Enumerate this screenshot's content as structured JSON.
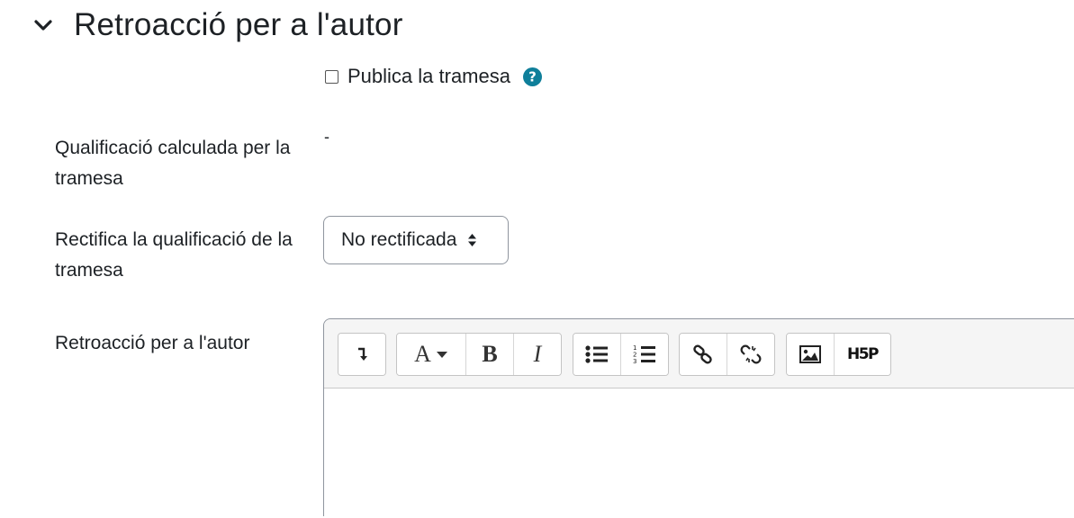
{
  "section": {
    "title": "Retroacció per a l'autor"
  },
  "publish": {
    "label": "Publica la tramesa",
    "checked": false
  },
  "grade_calculated": {
    "label": "Qualificació calculada per la tramesa",
    "value": "-"
  },
  "grade_override": {
    "label": "Rectifica la qualificació de la tramesa",
    "selected": "No rectificada"
  },
  "feedback": {
    "label": "Retroacció per a l'autor",
    "toolbar": {
      "font_letter": "A",
      "bold_letter": "B",
      "italic_letter": "I",
      "h5p_label": "H5P"
    }
  },
  "colors": {
    "help_icon": "#0f7f9a",
    "border": "#8f959e",
    "toolbar_bg": "#f5f5f5"
  },
  "icons": [
    "chevron-down-icon",
    "question-circle-icon",
    "sort-arrows-icon",
    "show-more-icon",
    "text-format-icon",
    "unordered-list-icon",
    "ordered-list-icon",
    "link-icon",
    "unlink-icon",
    "image-icon",
    "h5p-icon"
  ]
}
